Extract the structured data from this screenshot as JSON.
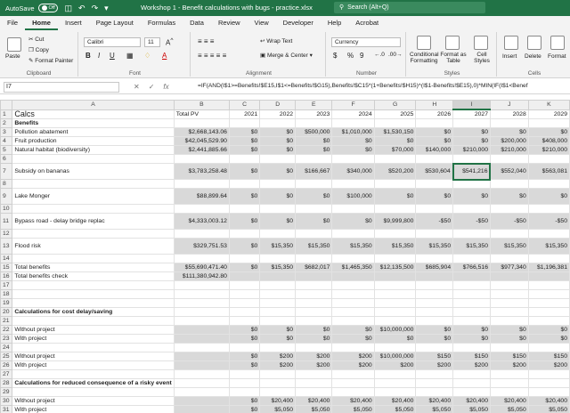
{
  "titlebar": {
    "autosave_label": "AutoSave",
    "autosave_state": "Off",
    "qat_icons": [
      "save-icon",
      "undo-icon",
      "redo-icon",
      "dropdown-icon"
    ],
    "document_title": "Workshop 1 - Benefit calculations with bugs - practice.xlsx",
    "search_placeholder": "Search (Alt+Q)"
  },
  "menu": {
    "tabs": [
      "File",
      "Home",
      "Insert",
      "Page Layout",
      "Formulas",
      "Data",
      "Review",
      "View",
      "Developer",
      "Help",
      "Acrobat"
    ],
    "active": "Home"
  },
  "ribbon": {
    "clipboard": {
      "group": "Clipboard",
      "paste": "Paste",
      "cut": "Cut",
      "copy": "Copy",
      "format_painter": "Format Painter"
    },
    "font": {
      "group": "Font",
      "font_name": "Calibri",
      "font_size": "11",
      "bold": "B",
      "italic": "I",
      "underline": "U"
    },
    "alignment": {
      "group": "Alignment",
      "wrap_text": "Wrap Text",
      "merge_center": "Merge & Center"
    },
    "number": {
      "group": "Number",
      "format": "Currency",
      "currency": "$",
      "percent": "%",
      "comma": "9"
    },
    "styles": {
      "group": "Styles",
      "conditional": "Conditional Formatting",
      "format_table": "Format as Table",
      "cell_styles": "Cell Styles"
    },
    "cells": {
      "group": "Cells",
      "insert": "Insert",
      "delete": "Delete",
      "format": "Format"
    }
  },
  "formula_bar": {
    "name_box": "I7",
    "cancel": "✕",
    "enter": "✓",
    "fx": "fx",
    "formula": "=IF(AND(I$1>=Benefits!$E15,I$1<=Benefits!$G15),Benefits!$C15*(1+Benefits!$H15)^(I$1-Benefits!$E15),0)*MIN(IF(I$1<Benef"
  },
  "sheet": {
    "columns": [
      "A",
      "B",
      "C",
      "D",
      "E",
      "F",
      "G",
      "H",
      "I",
      "J",
      "K"
    ],
    "selected_column": "I",
    "rows": [
      {
        "n": "1",
        "cells": [
          "Calcs",
          "Total PV",
          "2021",
          "2022",
          "2023",
          "2024",
          "2025",
          "2026",
          "2027",
          "2028",
          "2029"
        ]
      },
      {
        "n": "2",
        "cells": [
          "Benefits",
          "",
          "",
          "",
          "",
          "",
          "",
          "",
          "",
          "",
          ""
        ]
      },
      {
        "n": "3",
        "cells": [
          "Pollution abatement",
          "$2,668,143.06",
          "$0",
          "$0",
          "$500,000",
          "$1,010,000",
          "$1,530,150",
          "$0",
          "$0",
          "$0",
          "$0"
        ]
      },
      {
        "n": "4",
        "cells": [
          "Fruit production",
          "$42,045,529.90",
          "$0",
          "$0",
          "$0",
          "$0",
          "$0",
          "$0",
          "$0",
          "$200,000",
          "$408,000"
        ]
      },
      {
        "n": "5",
        "cells": [
          "Natural habitat (biodiversity)",
          "$2,441,885.66",
          "$0",
          "$0",
          "$0",
          "$0",
          "$70,000",
          "$140,000",
          "$210,000",
          "$210,000",
          "$210,000"
        ]
      },
      {
        "n": "6",
        "cells": [
          "",
          "",
          "",
          "",
          "",
          "",
          "",
          "",
          "",
          "",
          ""
        ]
      },
      {
        "n": "7",
        "cells": [
          "Subsidy on bananas",
          "$3,783,258.48",
          "$0",
          "$0",
          "$166,667",
          "$340,000",
          "$520,200",
          "$530,604",
          "$541,216",
          "$552,040",
          "$563,081"
        ]
      },
      {
        "n": "8",
        "cells": [
          "",
          "",
          "",
          "",
          "",
          "",
          "",
          "",
          "",
          "",
          ""
        ]
      },
      {
        "n": "9",
        "cells": [
          "Lake Monger",
          "$88,899.64",
          "$0",
          "$0",
          "$0",
          "$100,000",
          "$0",
          "$0",
          "$0",
          "$0",
          "$0"
        ]
      },
      {
        "n": "10",
        "cells": [
          "",
          "",
          "",
          "",
          "",
          "",
          "",
          "",
          "",
          "",
          ""
        ]
      },
      {
        "n": "11",
        "cells": [
          "Bypass road - delay bridge replac",
          "$4,333,003.12",
          "$0",
          "$0",
          "$0",
          "$0",
          "$9,999,800",
          "-$50",
          "-$50",
          "-$50",
          "-$50"
        ]
      },
      {
        "n": "12",
        "cells": [
          "",
          "",
          "",
          "",
          "",
          "",
          "",
          "",
          "",
          "",
          ""
        ]
      },
      {
        "n": "13",
        "cells": [
          "Flood risk",
          "$329,751.53",
          "$0",
          "$15,350",
          "$15,350",
          "$15,350",
          "$15,350",
          "$15,350",
          "$15,350",
          "$15,350",
          "$15,350"
        ]
      },
      {
        "n": "14",
        "cells": [
          "",
          "",
          "",
          "",
          "",
          "",
          "",
          "",
          "",
          "",
          ""
        ]
      },
      {
        "n": "15",
        "cells": [
          "Total benefits",
          "$55,690,471.40",
          "$0",
          "$15,350",
          "$682,017",
          "$1,465,350",
          "$12,135,500",
          "$685,904",
          "$766,516",
          "$977,340",
          "$1,196,381"
        ]
      },
      {
        "n": "16",
        "cells": [
          "Total benefits check",
          "$111,380,942.80",
          "",
          "",
          "",
          "",
          "",
          "",
          "",
          "",
          ""
        ]
      },
      {
        "n": "17",
        "cells": [
          "",
          "",
          "",
          "",
          "",
          "",
          "",
          "",
          "",
          "",
          ""
        ]
      },
      {
        "n": "18",
        "cells": [
          "",
          "",
          "",
          "",
          "",
          "",
          "",
          "",
          "",
          "",
          ""
        ]
      },
      {
        "n": "19",
        "cells": [
          "",
          "",
          "",
          "",
          "",
          "",
          "",
          "",
          "",
          "",
          ""
        ]
      },
      {
        "n": "20",
        "cells": [
          "Calculations for cost delay/saving",
          "",
          "",
          "",
          "",
          "",
          "",
          "",
          "",
          "",
          ""
        ]
      },
      {
        "n": "21",
        "cells": [
          "",
          "",
          "",
          "",
          "",
          "",
          "",
          "",
          "",
          "",
          ""
        ]
      },
      {
        "n": "22",
        "cells": [
          "Without project",
          "",
          "$0",
          "$0",
          "$0",
          "$0",
          "$10,000,000",
          "$0",
          "$0",
          "$0",
          "$0"
        ]
      },
      {
        "n": "23",
        "cells": [
          "With project",
          "",
          "$0",
          "$0",
          "$0",
          "$0",
          "$0",
          "$0",
          "$0",
          "$0",
          "$0"
        ]
      },
      {
        "n": "24",
        "cells": [
          "",
          "",
          "",
          "",
          "",
          "",
          "",
          "",
          "",
          "",
          ""
        ]
      },
      {
        "n": "25",
        "cells": [
          "Without project",
          "",
          "$0",
          "$200",
          "$200",
          "$200",
          "$10,000,000",
          "$150",
          "$150",
          "$150",
          "$150"
        ]
      },
      {
        "n": "26",
        "cells": [
          "With project",
          "",
          "$0",
          "$200",
          "$200",
          "$200",
          "$200",
          "$200",
          "$200",
          "$200",
          "$200"
        ]
      },
      {
        "n": "27",
        "cells": [
          "",
          "",
          "",
          "",
          "",
          "",
          "",
          "",
          "",
          "",
          ""
        ]
      },
      {
        "n": "28",
        "cells": [
          "Calculations for reduced consequence of a risky event",
          "",
          "",
          "",
          "",
          "",
          "",
          "",
          "",
          "",
          ""
        ]
      },
      {
        "n": "29",
        "cells": [
          "",
          "",
          "",
          "",
          "",
          "",
          "",
          "",
          "",
          "",
          ""
        ]
      },
      {
        "n": "30",
        "cells": [
          "Without project",
          "",
          "$0",
          "$20,400",
          "$20,400",
          "$20,400",
          "$20,400",
          "$20,400",
          "$20,400",
          "$20,400",
          "$20,400"
        ]
      },
      {
        "n": "31",
        "cells": [
          "With project",
          "",
          "$0",
          "$5,050",
          "$5,050",
          "$5,050",
          "$5,050",
          "$5,050",
          "$5,050",
          "$5,050",
          "$5,050"
        ]
      }
    ]
  },
  "colors": {
    "excel_green": "#217346",
    "shade": "#d9d9d9",
    "header": "#efefef"
  }
}
